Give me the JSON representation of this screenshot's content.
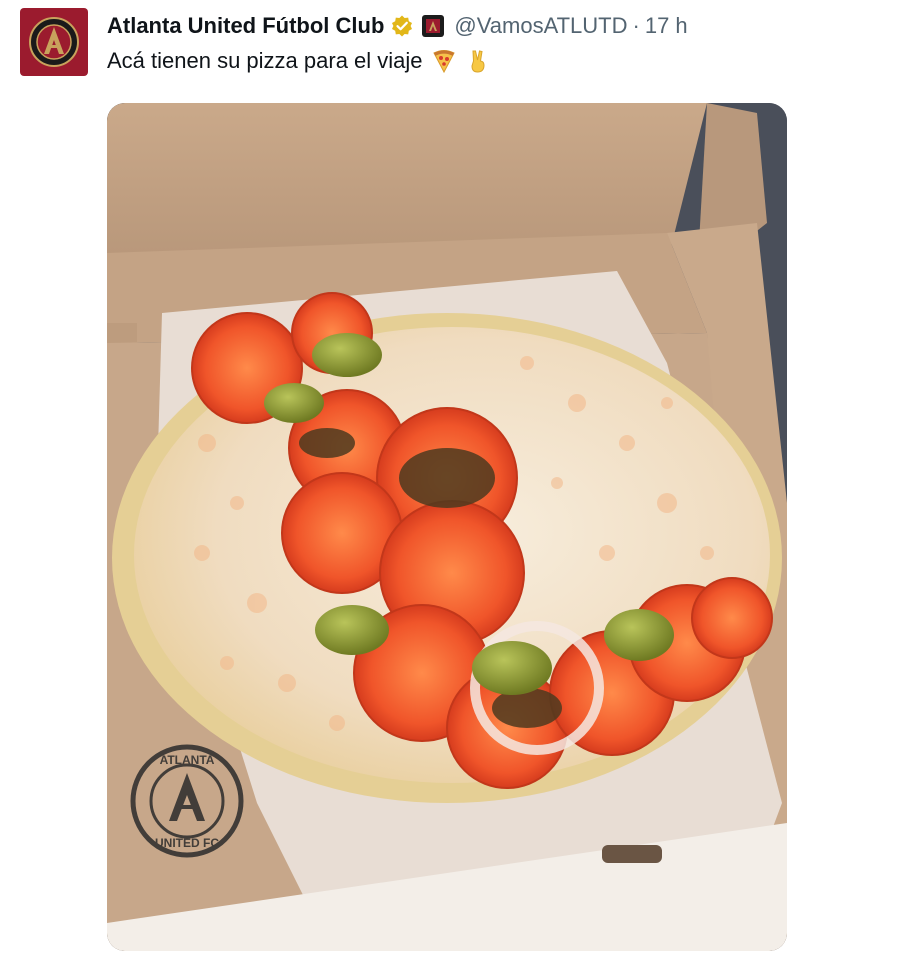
{
  "tweet": {
    "display_name": "Atlanta United Fútbol Club",
    "handle": "@VamosATLUTD",
    "separator": "·",
    "time": "17 h",
    "text": "Acá tienen su pizza para el viaje",
    "verified_badge_color": "#e2b719",
    "avatar_color": "#9b1b2e"
  },
  "icons": {
    "verified": "gold-verified-badge-icon",
    "affiliate": "club-crest-icon",
    "pizza": "pizza-emoji-icon",
    "victory": "victory-hand-emoji-icon"
  },
  "media": {
    "watermark_logo": {
      "top_text": "ATLANTA",
      "bottom_text": "UNITED FC"
    }
  }
}
